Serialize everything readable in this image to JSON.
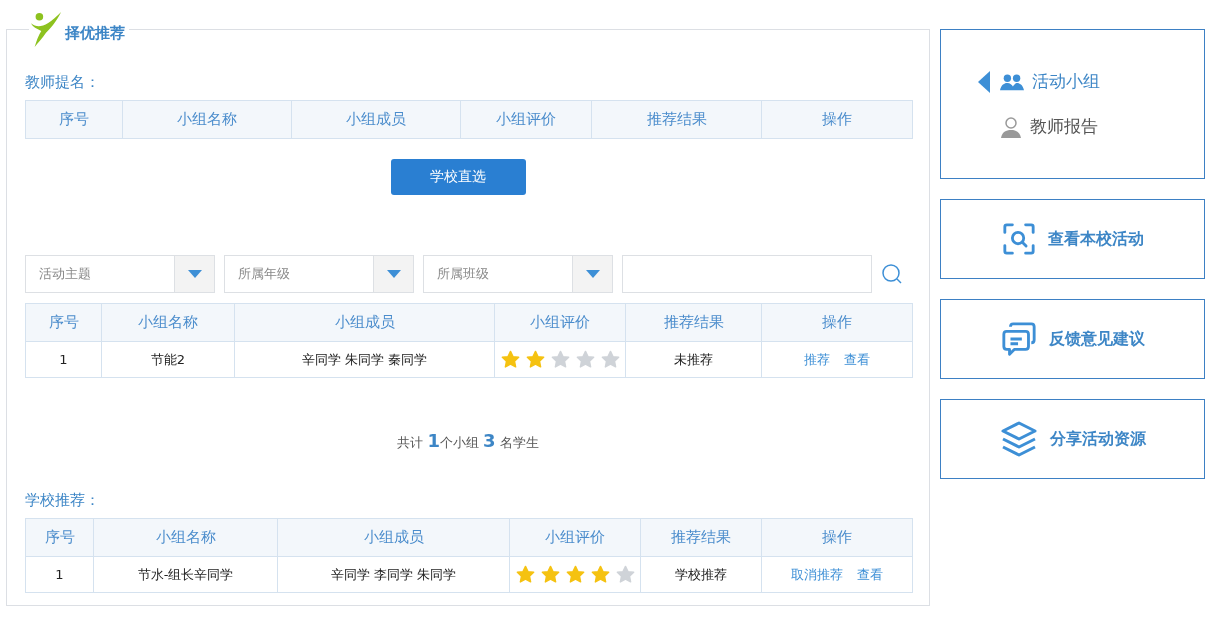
{
  "panel": {
    "title": "择优推荐"
  },
  "nominated": {
    "label": "教师提名：",
    "columns": [
      "序号",
      "小组名称",
      "小组成员",
      "小组评价",
      "推荐结果",
      "操作"
    ]
  },
  "direct_button": "学校直选",
  "filters": [
    {
      "placeholder": "活动主题"
    },
    {
      "placeholder": "所属年级"
    },
    {
      "placeholder": "所属班级"
    }
  ],
  "groups": {
    "columns": [
      "序号",
      "小组名称",
      "小组成员",
      "小组评价",
      "推荐结果",
      "操作"
    ],
    "rows": [
      {
        "index": "1",
        "name": "节能2",
        "members": "辛同学 朱同学 秦同学",
        "stars": 2,
        "result": "未推荐",
        "actions": [
          "推荐",
          "查看"
        ]
      }
    ]
  },
  "summary": "共计 **1**个小组 **3** 名学生",
  "school": {
    "label": "学校推荐：",
    "columns": [
      "序号",
      "小组名称",
      "小组成员",
      "小组评价",
      "推荐结果",
      "操作"
    ],
    "rows": [
      {
        "index": "1",
        "name": "节水-组长辛同学",
        "members": "辛同学 李同学 朱同学",
        "stars": 4,
        "result": "学校推荐",
        "actions": [
          "取消推荐",
          "查看"
        ]
      }
    ]
  },
  "sidebar": {
    "nav": [
      {
        "label": "活动小组",
        "selected": true
      },
      {
        "label": "教师报告",
        "selected": false
      }
    ],
    "cards": [
      "查看本校活动",
      "反馈意见建议",
      "分享活动资源"
    ]
  }
}
